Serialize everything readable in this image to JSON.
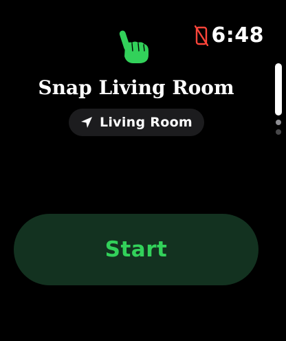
{
  "status_bar": {
    "time": "6:48",
    "indicator_icon": "phone-disconnected-icon",
    "indicator_color": "#ff453a"
  },
  "app": {
    "icon": "hand-pointing-icon",
    "icon_color": "#32d15a",
    "title": "Snap Living Room"
  },
  "location": {
    "icon": "location-arrow-icon",
    "label": "Living Room"
  },
  "scroll": {
    "thumb_color": "#ffffff",
    "dot_colors": [
      "#8e8e93",
      "#48484a"
    ]
  },
  "action": {
    "start_label": "Start",
    "background": "#133220",
    "text_color": "#32d15a"
  }
}
